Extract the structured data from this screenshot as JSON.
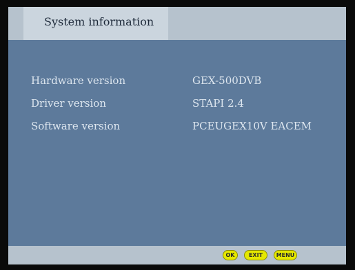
{
  "header": {
    "title": "System information"
  },
  "info": {
    "rows": [
      {
        "label": "Hardware version",
        "value": "GEX-500DVB"
      },
      {
        "label": "Driver version",
        "value": "STAPI 2.4"
      },
      {
        "label": "Software version",
        "value": "PCEUGEX10V EACEM"
      }
    ]
  },
  "footer": {
    "buttons": {
      "ok": "OK",
      "exit": "EXIT",
      "menu": "MENU"
    }
  },
  "colors": {
    "panel": "#5d7a9b",
    "title_bar": "#b6c2cd",
    "button": "#e5e800"
  }
}
